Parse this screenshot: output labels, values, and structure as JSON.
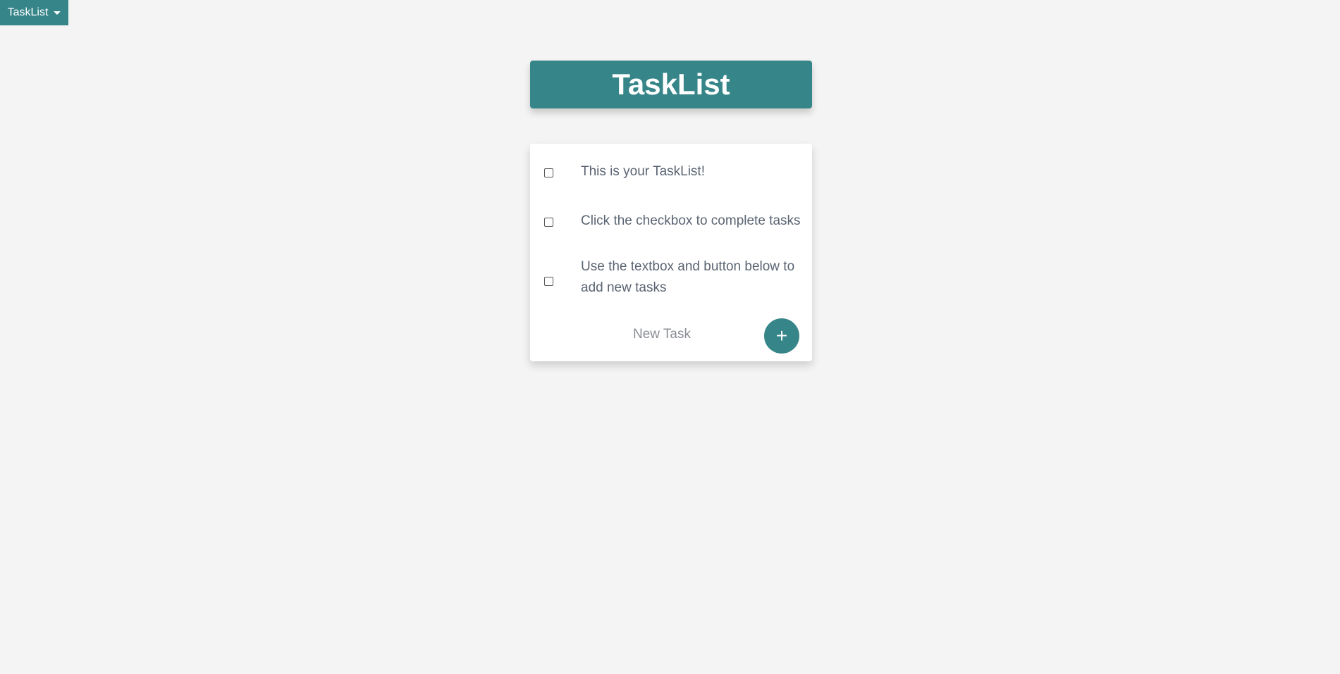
{
  "nav": {
    "menu_label": "TaskList",
    "menu_icon": "caret-down-icon"
  },
  "header": {
    "title": "TaskList"
  },
  "tasks": [
    {
      "label": "This is your TaskList!",
      "completed": false
    },
    {
      "label": "Click the checkbox to complete tasks",
      "completed": false
    },
    {
      "label": "Use the textbox and button below to add new tasks",
      "completed": false
    }
  ],
  "new_task": {
    "placeholder": "New Task",
    "value": "",
    "add_button_label": "+"
  },
  "colors": {
    "accent": "#368589",
    "background": "#f4f4f4",
    "card": "#ffffff",
    "text": "#5a6472"
  }
}
